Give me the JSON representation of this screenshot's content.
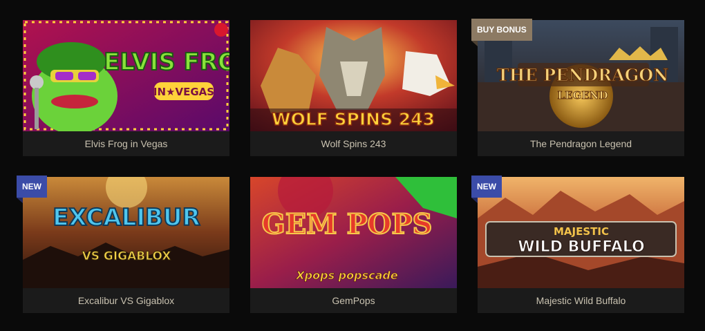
{
  "games": [
    {
      "title": "Elvis Frog in Vegas",
      "badge": "",
      "art": "ELVIS FROG",
      "art_sub": "IN★VEGAS"
    },
    {
      "title": "Wolf Spins 243",
      "badge": "",
      "art": "WOLF SPINS 243",
      "art_sub": ""
    },
    {
      "title": "The Pendragon Legend",
      "badge": "BUY BONUS",
      "art": "THE PENDRAGON",
      "art_sub": "LEGEND"
    },
    {
      "title": "Excalibur VS Gigablox",
      "badge": "NEW",
      "art": "EXCALIBUR",
      "art_sub": "VS GIGABLOX"
    },
    {
      "title": "GemPops",
      "badge": "",
      "art": "GEM POPS",
      "art_sub": "Xpops popscade"
    },
    {
      "title": "Majestic Wild Buffalo",
      "badge": "NEW",
      "art": "MAJESTIC",
      "art_sub": "WILD BUFFALO"
    }
  ],
  "colors": {
    "page_bg": "#0a0a0a",
    "caption_bg": "#1b1b1b",
    "caption_text": "#c9c2b0",
    "badge_new": "#3b4ca8",
    "badge_buy": "#8c7a63"
  }
}
